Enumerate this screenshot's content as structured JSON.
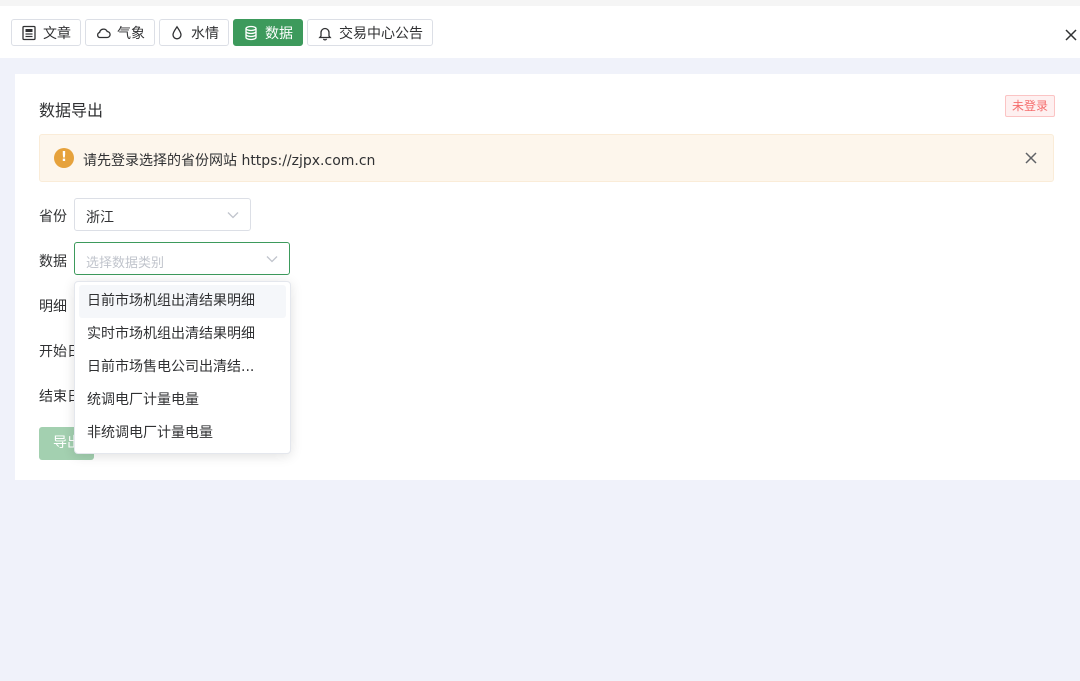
{
  "tabs": [
    {
      "label": "文章",
      "icon": "article-icon",
      "active": false
    },
    {
      "label": "气象",
      "icon": "cloud-icon",
      "active": false
    },
    {
      "label": "水情",
      "icon": "water-drop-icon",
      "active": false
    },
    {
      "label": "数据",
      "icon": "database-icon",
      "active": true
    },
    {
      "label": "交易中心公告",
      "icon": "bell-icon",
      "active": false
    }
  ],
  "card": {
    "title": "数据导出",
    "status_badge": "未登录",
    "alert": {
      "message": "请先登录选择的省份网站 https://zjpx.com.cn",
      "icon": "warning-icon"
    }
  },
  "form": {
    "province_label": "省份",
    "province_value": "浙江",
    "data_label": "数据",
    "data_placeholder": "选择数据类别",
    "detail_label": "明细",
    "start_date_label": "开始日",
    "end_date_label": "结束日",
    "export_button": "导出"
  },
  "dropdown": {
    "options": [
      "日前市场机组出清结果明细",
      "实时市场机组出清结果明细",
      "日前市场售电公司出清结...",
      "统调电厂计量电量",
      "非统调电厂计量电量"
    ],
    "hovered_index": 0
  },
  "colors": {
    "primary": "#3d9a5c",
    "warning": "#e6a23c",
    "danger": "#f56c6c",
    "background": "#f0f2fa"
  }
}
